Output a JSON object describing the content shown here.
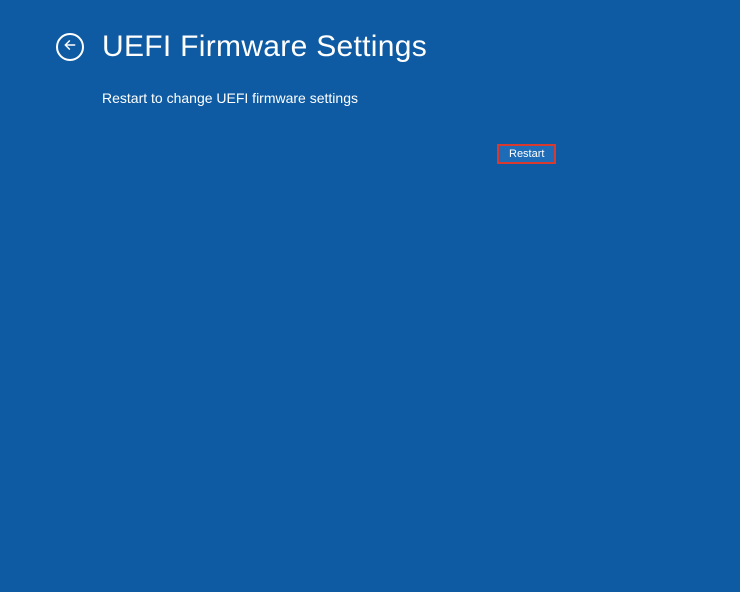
{
  "header": {
    "title": "UEFI Firmware Settings"
  },
  "main": {
    "subtitle": "Restart to change UEFI firmware settings",
    "restart_label": "Restart"
  }
}
